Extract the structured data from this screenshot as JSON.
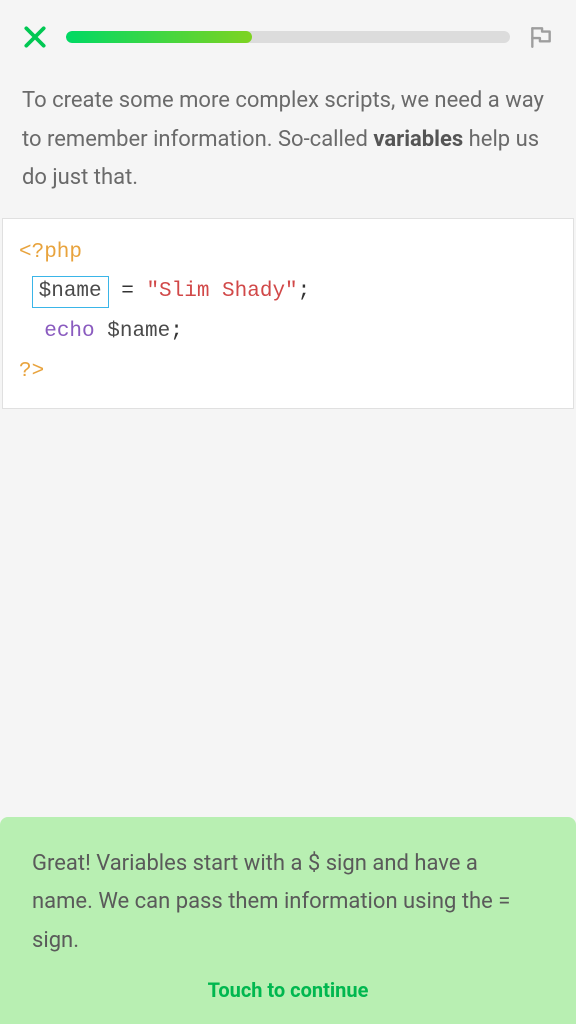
{
  "progress": {
    "percent": 42
  },
  "instruction": {
    "pre": "To create some more complex scripts, we need a way to remember information. So-called ",
    "bold": "variables",
    "post": " help us do just that."
  },
  "code": {
    "open_tag": "<?php",
    "var_blank": "$name",
    "assign_op": " = ",
    "string_val": "\"Slim Shady\"",
    "semi1": ";",
    "echo_kw": "echo",
    "echo_sp": " ",
    "var_ref": "$name",
    "semi2": ";",
    "close_tag": "?>"
  },
  "feedback": {
    "text": "Great! Variables start with a $ sign and have a name. We can pass them information using the = sign.",
    "continue_label": "Touch to continue"
  }
}
